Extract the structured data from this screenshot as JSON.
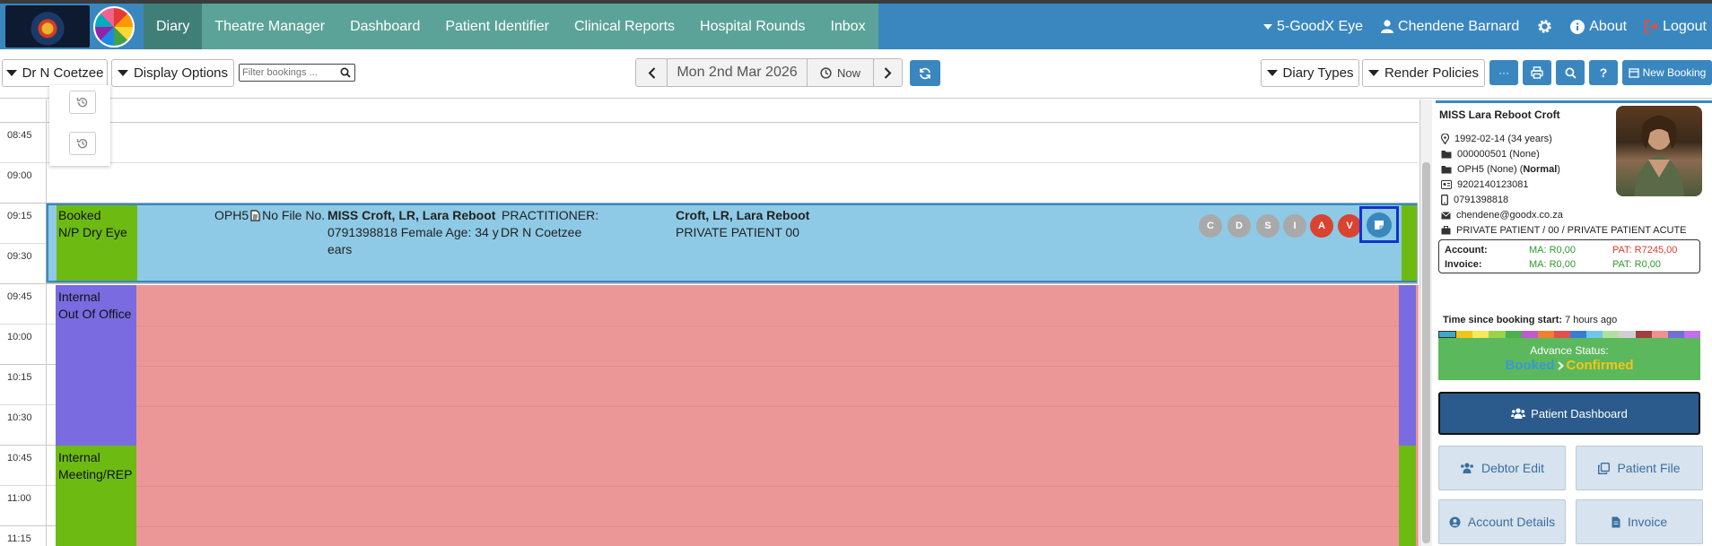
{
  "nav": {
    "tabs": [
      "Diary",
      "Theatre Manager",
      "Dashboard",
      "Patient Identifier",
      "Clinical Reports",
      "Hospital Rounds",
      "Inbox"
    ],
    "practice": "5-GoodX Eye",
    "user": "Chendene Barnard",
    "about": "About",
    "logout": "Logout"
  },
  "toolbar": {
    "doctor": "Dr N Coetzee",
    "display_options": "Display Options",
    "filter_placeholder": "Filter bookings ...",
    "date": "Mon 2nd Mar 2026",
    "now": "Now",
    "diary_types": "Diary Types",
    "render_policies": "Render Policies",
    "more": "···",
    "help": "?",
    "new_booking": "New Booking"
  },
  "times": [
    "08:45",
    "09:00",
    "09:15",
    "09:30",
    "09:45",
    "10:00",
    "10:15",
    "10:30",
    "10:45",
    "11:00",
    "11:15"
  ],
  "booking": {
    "status": "Booked",
    "type": "N/P Dry Eye",
    "code": "OPH5",
    "file": "No File No.",
    "patient_name": "MISS Croft, LR, Lara Reboot",
    "practitioner_label": "PRACTITIONER:",
    "details": "0791398818 Female Age: 34 y",
    "practitioner": "DR N Coetzee",
    "extra": "ears",
    "debtor_name": "Croft, LR, Lara Reboot",
    "debtor_type": "PRIVATE PATIENT 00",
    "badges": [
      {
        "label": "C",
        "color": "#9e9e9e"
      },
      {
        "label": "D",
        "color": "#9e9e9e"
      },
      {
        "label": "S",
        "color": "#9e9e9e"
      },
      {
        "label": "I",
        "color": "#9e9e9e"
      },
      {
        "label": "A",
        "color": "#d9432f"
      },
      {
        "label": "V",
        "color": "#d9432f"
      }
    ]
  },
  "blocks": {
    "oof_line1": "Internal",
    "oof_line2": "Out Of Office",
    "meet_line1": "Internal",
    "meet_line2": "Meeting/REP"
  },
  "patient": {
    "name": "MISS Lara Reboot Croft",
    "dob": "1992-02-14 (34 years)",
    "file": "000000501 (None)",
    "plan": "OPH5 (None) (",
    "plan_status": "Normal",
    "plan_end": ")",
    "id_number": "9202140123081",
    "phone": "0791398818",
    "email": "chendene@goodx.co.za",
    "debtor": "PRIVATE PATIENT / 00 / PRIVATE PATIENT ACUTE",
    "account_label": "Account:",
    "account_ma": "MA: R0,00",
    "account_pat": "PAT: R7245,00",
    "invoice_label": "Invoice:",
    "invoice_ma": "MA: R0,00",
    "invoice_pat": "PAT: R0,00",
    "time_since_label": "Time since booking start:",
    "time_since_value": "7 hours ago",
    "advance_label": "Advance Status:",
    "status_from": "Booked",
    "status_to": "Confirmed",
    "btn_dashboard": "Patient Dashboard",
    "btn_debtor": "Debtor Edit",
    "btn_file": "Patient File",
    "btn_account": "Account Details",
    "btn_invoice": "Invoice"
  },
  "colors": {
    "nav": "#3a87c0",
    "nav_tabs": "#5ba398",
    "booked": "#8ecae6",
    "green": "#6dbb12",
    "purple": "#7a6be0",
    "pink": "#ec9797",
    "advance_green": "#5cb85c",
    "dashboard_btn": "#2a5b8c"
  },
  "status_stripe": [
    "#3fa9c9",
    "#f2c418",
    "#f5e85a",
    "#9bd24a",
    "#4cb050",
    "#c05ad0",
    "#f08030",
    "#e05050",
    "#3a7bd5",
    "#6ec6e8",
    "#b0e0a0",
    "#d0d0d0",
    "#a04040",
    "#f09090",
    "#7070d0",
    "#c070f0"
  ]
}
